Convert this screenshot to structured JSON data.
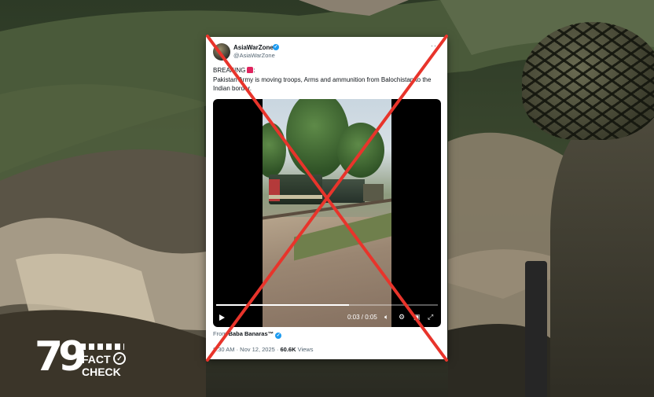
{
  "tweet": {
    "display_name": "AsiaWarZone",
    "handle": "@AsiaWarZone",
    "more": "···",
    "text_breaking": "BREAKING",
    "text_colon": ":",
    "text_body": "Pakistan Army is moving troops, Arms and ammunition from Balochistan to the Indian border.",
    "video": {
      "time": "0:03 / 0:05",
      "progress": 0.6
    },
    "from_prefix": "From",
    "from_name": "Baba Banaras™",
    "timestamp": "8:30 AM · Nov 12, 2025 ·",
    "views_count": "60.6K",
    "views_label": "Views"
  },
  "logo": {
    "number": "79",
    "word1": "FACT",
    "word2": "CHECK"
  },
  "colors": {
    "x_mark": "#e8342b",
    "verified": "#1d9bf0"
  }
}
